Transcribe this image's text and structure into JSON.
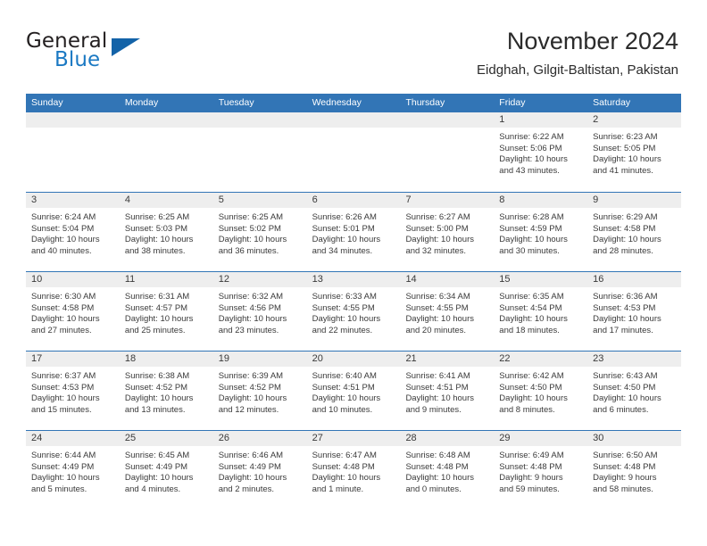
{
  "brand": {
    "name_part1": "General",
    "name_part2": "Blue",
    "triangle_color": "#1363a8",
    "blue_text_color": "#1b79c3"
  },
  "header": {
    "title": "November 2024",
    "subtitle": "Eidghah, Gilgit-Baltistan, Pakistan"
  },
  "theme": {
    "header_blue": "#3275b6",
    "day_band_gray": "#eeeeee",
    "text_color": "#3a3a3a"
  },
  "weekdays": [
    "Sunday",
    "Monday",
    "Tuesday",
    "Wednesday",
    "Thursday",
    "Friday",
    "Saturday"
  ],
  "weeks": [
    [
      {
        "day": "",
        "empty": true,
        "sunrise": "",
        "sunset": "",
        "daylight1": "",
        "daylight2": ""
      },
      {
        "day": "",
        "empty": true,
        "sunrise": "",
        "sunset": "",
        "daylight1": "",
        "daylight2": ""
      },
      {
        "day": "",
        "empty": true,
        "sunrise": "",
        "sunset": "",
        "daylight1": "",
        "daylight2": ""
      },
      {
        "day": "",
        "empty": true,
        "sunrise": "",
        "sunset": "",
        "daylight1": "",
        "daylight2": ""
      },
      {
        "day": "",
        "empty": true,
        "sunrise": "",
        "sunset": "",
        "daylight1": "",
        "daylight2": ""
      },
      {
        "day": "1",
        "empty": false,
        "sunrise": "Sunrise: 6:22 AM",
        "sunset": "Sunset: 5:06 PM",
        "daylight1": "Daylight: 10 hours",
        "daylight2": "and 43 minutes."
      },
      {
        "day": "2",
        "empty": false,
        "sunrise": "Sunrise: 6:23 AM",
        "sunset": "Sunset: 5:05 PM",
        "daylight1": "Daylight: 10 hours",
        "daylight2": "and 41 minutes."
      }
    ],
    [
      {
        "day": "3",
        "empty": false,
        "sunrise": "Sunrise: 6:24 AM",
        "sunset": "Sunset: 5:04 PM",
        "daylight1": "Daylight: 10 hours",
        "daylight2": "and 40 minutes."
      },
      {
        "day": "4",
        "empty": false,
        "sunrise": "Sunrise: 6:25 AM",
        "sunset": "Sunset: 5:03 PM",
        "daylight1": "Daylight: 10 hours",
        "daylight2": "and 38 minutes."
      },
      {
        "day": "5",
        "empty": false,
        "sunrise": "Sunrise: 6:25 AM",
        "sunset": "Sunset: 5:02 PM",
        "daylight1": "Daylight: 10 hours",
        "daylight2": "and 36 minutes."
      },
      {
        "day": "6",
        "empty": false,
        "sunrise": "Sunrise: 6:26 AM",
        "sunset": "Sunset: 5:01 PM",
        "daylight1": "Daylight: 10 hours",
        "daylight2": "and 34 minutes."
      },
      {
        "day": "7",
        "empty": false,
        "sunrise": "Sunrise: 6:27 AM",
        "sunset": "Sunset: 5:00 PM",
        "daylight1": "Daylight: 10 hours",
        "daylight2": "and 32 minutes."
      },
      {
        "day": "8",
        "empty": false,
        "sunrise": "Sunrise: 6:28 AM",
        "sunset": "Sunset: 4:59 PM",
        "daylight1": "Daylight: 10 hours",
        "daylight2": "and 30 minutes."
      },
      {
        "day": "9",
        "empty": false,
        "sunrise": "Sunrise: 6:29 AM",
        "sunset": "Sunset: 4:58 PM",
        "daylight1": "Daylight: 10 hours",
        "daylight2": "and 28 minutes."
      }
    ],
    [
      {
        "day": "10",
        "empty": false,
        "sunrise": "Sunrise: 6:30 AM",
        "sunset": "Sunset: 4:58 PM",
        "daylight1": "Daylight: 10 hours",
        "daylight2": "and 27 minutes."
      },
      {
        "day": "11",
        "empty": false,
        "sunrise": "Sunrise: 6:31 AM",
        "sunset": "Sunset: 4:57 PM",
        "daylight1": "Daylight: 10 hours",
        "daylight2": "and 25 minutes."
      },
      {
        "day": "12",
        "empty": false,
        "sunrise": "Sunrise: 6:32 AM",
        "sunset": "Sunset: 4:56 PM",
        "daylight1": "Daylight: 10 hours",
        "daylight2": "and 23 minutes."
      },
      {
        "day": "13",
        "empty": false,
        "sunrise": "Sunrise: 6:33 AM",
        "sunset": "Sunset: 4:55 PM",
        "daylight1": "Daylight: 10 hours",
        "daylight2": "and 22 minutes."
      },
      {
        "day": "14",
        "empty": false,
        "sunrise": "Sunrise: 6:34 AM",
        "sunset": "Sunset: 4:55 PM",
        "daylight1": "Daylight: 10 hours",
        "daylight2": "and 20 minutes."
      },
      {
        "day": "15",
        "empty": false,
        "sunrise": "Sunrise: 6:35 AM",
        "sunset": "Sunset: 4:54 PM",
        "daylight1": "Daylight: 10 hours",
        "daylight2": "and 18 minutes."
      },
      {
        "day": "16",
        "empty": false,
        "sunrise": "Sunrise: 6:36 AM",
        "sunset": "Sunset: 4:53 PM",
        "daylight1": "Daylight: 10 hours",
        "daylight2": "and 17 minutes."
      }
    ],
    [
      {
        "day": "17",
        "empty": false,
        "sunrise": "Sunrise: 6:37 AM",
        "sunset": "Sunset: 4:53 PM",
        "daylight1": "Daylight: 10 hours",
        "daylight2": "and 15 minutes."
      },
      {
        "day": "18",
        "empty": false,
        "sunrise": "Sunrise: 6:38 AM",
        "sunset": "Sunset: 4:52 PM",
        "daylight1": "Daylight: 10 hours",
        "daylight2": "and 13 minutes."
      },
      {
        "day": "19",
        "empty": false,
        "sunrise": "Sunrise: 6:39 AM",
        "sunset": "Sunset: 4:52 PM",
        "daylight1": "Daylight: 10 hours",
        "daylight2": "and 12 minutes."
      },
      {
        "day": "20",
        "empty": false,
        "sunrise": "Sunrise: 6:40 AM",
        "sunset": "Sunset: 4:51 PM",
        "daylight1": "Daylight: 10 hours",
        "daylight2": "and 10 minutes."
      },
      {
        "day": "21",
        "empty": false,
        "sunrise": "Sunrise: 6:41 AM",
        "sunset": "Sunset: 4:51 PM",
        "daylight1": "Daylight: 10 hours",
        "daylight2": "and 9 minutes."
      },
      {
        "day": "22",
        "empty": false,
        "sunrise": "Sunrise: 6:42 AM",
        "sunset": "Sunset: 4:50 PM",
        "daylight1": "Daylight: 10 hours",
        "daylight2": "and 8 minutes."
      },
      {
        "day": "23",
        "empty": false,
        "sunrise": "Sunrise: 6:43 AM",
        "sunset": "Sunset: 4:50 PM",
        "daylight1": "Daylight: 10 hours",
        "daylight2": "and 6 minutes."
      }
    ],
    [
      {
        "day": "24",
        "empty": false,
        "sunrise": "Sunrise: 6:44 AM",
        "sunset": "Sunset: 4:49 PM",
        "daylight1": "Daylight: 10 hours",
        "daylight2": "and 5 minutes."
      },
      {
        "day": "25",
        "empty": false,
        "sunrise": "Sunrise: 6:45 AM",
        "sunset": "Sunset: 4:49 PM",
        "daylight1": "Daylight: 10 hours",
        "daylight2": "and 4 minutes."
      },
      {
        "day": "26",
        "empty": false,
        "sunrise": "Sunrise: 6:46 AM",
        "sunset": "Sunset: 4:49 PM",
        "daylight1": "Daylight: 10 hours",
        "daylight2": "and 2 minutes."
      },
      {
        "day": "27",
        "empty": false,
        "sunrise": "Sunrise: 6:47 AM",
        "sunset": "Sunset: 4:48 PM",
        "daylight1": "Daylight: 10 hours",
        "daylight2": "and 1 minute."
      },
      {
        "day": "28",
        "empty": false,
        "sunrise": "Sunrise: 6:48 AM",
        "sunset": "Sunset: 4:48 PM",
        "daylight1": "Daylight: 10 hours",
        "daylight2": "and 0 minutes."
      },
      {
        "day": "29",
        "empty": false,
        "sunrise": "Sunrise: 6:49 AM",
        "sunset": "Sunset: 4:48 PM",
        "daylight1": "Daylight: 9 hours",
        "daylight2": "and 59 minutes."
      },
      {
        "day": "30",
        "empty": false,
        "sunrise": "Sunrise: 6:50 AM",
        "sunset": "Sunset: 4:48 PM",
        "daylight1": "Daylight: 9 hours",
        "daylight2": "and 58 minutes."
      }
    ]
  ]
}
